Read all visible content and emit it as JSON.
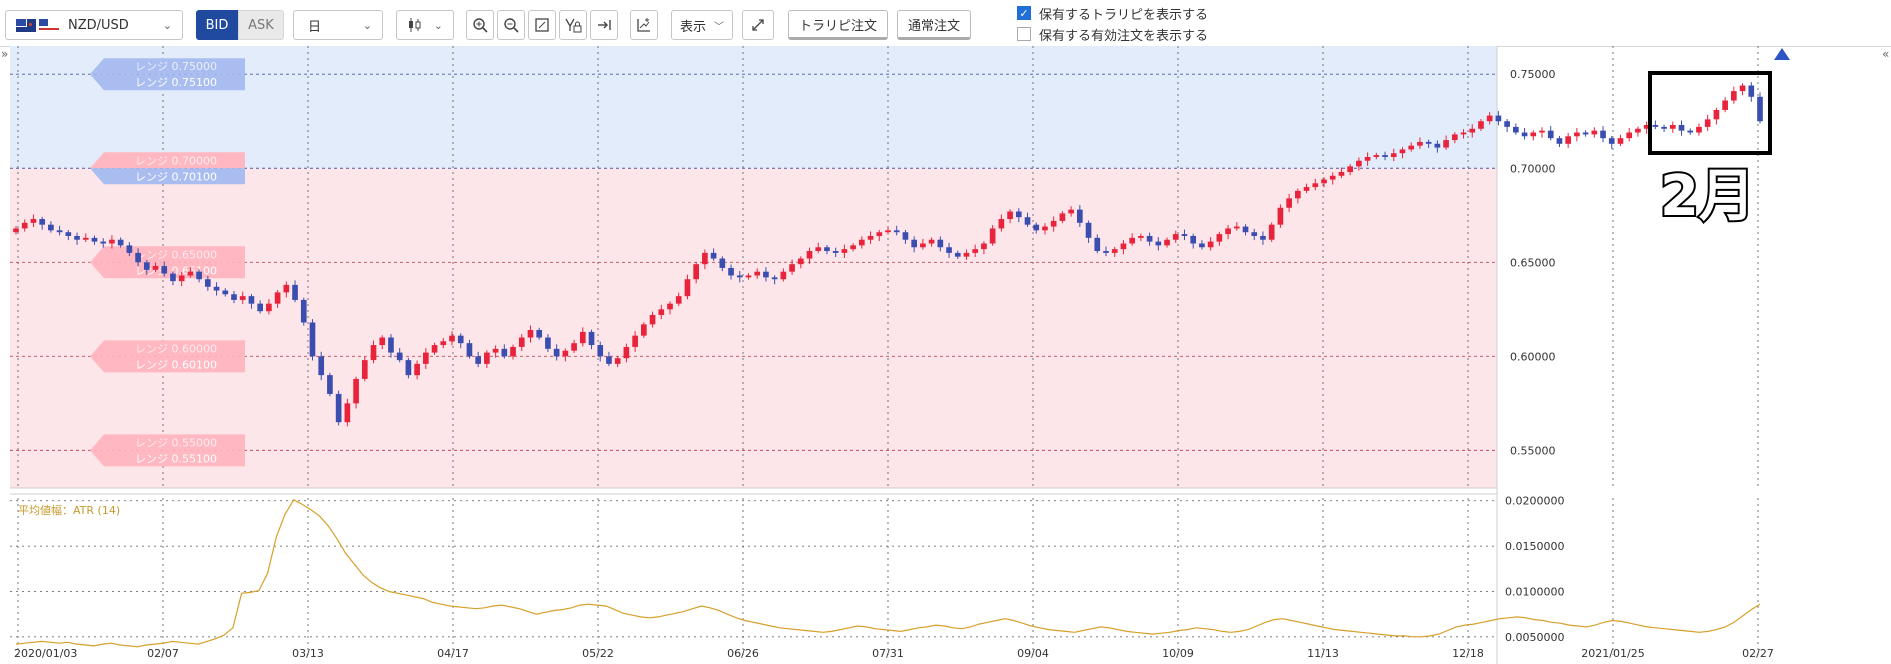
{
  "toolbar": {
    "pair_label": "NZD/USD",
    "bid_label": "BID",
    "ask_label": "ASK",
    "period_label": "日",
    "display_label": "表示",
    "trail_order_label": "トラリピ注文",
    "normal_order_label": "通常注文",
    "show_positions_label": "保有するトラリピを表示する",
    "show_positions_checked": true,
    "show_orders_label": "保有する有効注文を表示する",
    "show_orders_checked": false
  },
  "colors": {
    "up_candle": "#e8243c",
    "down_candle": "#3b4eb0",
    "range_blue_bg": "#e3ecfb",
    "range_pink_bg": "#fde6ea",
    "atr_line": "#d6a02a",
    "annotation": "#000000"
  },
  "annotation": {
    "label": "2月"
  },
  "range_labels": [
    {
      "top": "レンジ 0.75000",
      "bottom": "レンジ 0.75100",
      "side": "blue"
    },
    {
      "top": "レンジ 0.70000",
      "bottom": "レンジ 0.70100",
      "side": "split"
    },
    {
      "top": "レンジ 0.65000",
      "bottom": "レンジ 0.65100",
      "side": "pink"
    },
    {
      "top": "レンジ 0.60000",
      "bottom": "レンジ 0.60100",
      "side": "pink"
    },
    {
      "top": "レンジ 0.55000",
      "bottom": "レンジ 0.55100",
      "side": "pink"
    }
  ],
  "chart_data": [
    {
      "type": "candlestick",
      "ylim": [
        0.53,
        0.765
      ],
      "y_ticks": [
        "0.75000",
        "0.70000",
        "0.65000",
        "0.60000",
        "0.55000"
      ],
      "y_tick_values": [
        0.75,
        0.7,
        0.65,
        0.6,
        0.55
      ],
      "x_ticks": [
        "2020/01/03",
        "02/07",
        "03/13",
        "04/17",
        "05/22",
        "06/26",
        "07/31",
        "09/04",
        "10/09",
        "11/13",
        "12/18",
        "2021/01/25",
        "02/27"
      ],
      "grid": true,
      "closes": [
        0.668,
        0.671,
        0.673,
        0.67,
        0.667,
        0.666,
        0.664,
        0.662,
        0.663,
        0.661,
        0.66,
        0.662,
        0.659,
        0.655,
        0.65,
        0.646,
        0.648,
        0.644,
        0.64,
        0.643,
        0.645,
        0.641,
        0.637,
        0.635,
        0.633,
        0.63,
        0.632,
        0.628,
        0.624,
        0.628,
        0.634,
        0.638,
        0.63,
        0.618,
        0.6,
        0.59,
        0.58,
        0.565,
        0.575,
        0.588,
        0.598,
        0.606,
        0.61,
        0.602,
        0.598,
        0.59,
        0.596,
        0.602,
        0.606,
        0.608,
        0.611,
        0.607,
        0.6,
        0.596,
        0.602,
        0.604,
        0.6,
        0.605,
        0.61,
        0.614,
        0.61,
        0.604,
        0.6,
        0.603,
        0.607,
        0.613,
        0.606,
        0.6,
        0.596,
        0.599,
        0.605,
        0.611,
        0.617,
        0.622,
        0.625,
        0.628,
        0.632,
        0.641,
        0.649,
        0.655,
        0.652,
        0.647,
        0.643,
        0.642,
        0.643,
        0.645,
        0.642,
        0.641,
        0.645,
        0.649,
        0.652,
        0.656,
        0.658,
        0.656,
        0.655,
        0.657,
        0.659,
        0.662,
        0.664,
        0.666,
        0.667,
        0.666,
        0.662,
        0.658,
        0.66,
        0.662,
        0.658,
        0.655,
        0.653,
        0.655,
        0.657,
        0.66,
        0.668,
        0.673,
        0.677,
        0.674,
        0.67,
        0.667,
        0.669,
        0.672,
        0.676,
        0.678,
        0.671,
        0.663,
        0.656,
        0.655,
        0.657,
        0.66,
        0.663,
        0.664,
        0.661,
        0.659,
        0.662,
        0.665,
        0.664,
        0.66,
        0.658,
        0.661,
        0.665,
        0.668,
        0.669,
        0.666,
        0.664,
        0.662,
        0.67,
        0.679,
        0.684,
        0.688,
        0.69,
        0.692,
        0.694,
        0.696,
        0.698,
        0.701,
        0.704,
        0.706,
        0.707,
        0.706,
        0.708,
        0.71,
        0.712,
        0.714,
        0.713,
        0.711,
        0.715,
        0.718,
        0.719,
        0.721,
        0.725,
        0.728,
        0.725,
        0.722,
        0.719,
        0.717,
        0.719,
        0.72,
        0.716,
        0.713,
        0.717,
        0.719,
        0.718,
        0.72,
        0.716,
        0.713,
        0.716,
        0.719,
        0.721,
        0.723,
        0.722,
        0.721,
        0.723,
        0.72,
        0.719,
        0.722,
        0.726,
        0.731,
        0.736,
        0.741,
        0.744,
        0.738,
        0.725
      ]
    },
    {
      "type": "line",
      "series": [
        {
          "name": "平均値幅：ATR (14)"
        }
      ],
      "ylim": [
        0.003,
        0.0203
      ],
      "y_ticks": [
        "0.0200000",
        "0.0150000",
        "0.0100000",
        "0.0050000"
      ],
      "y_tick_values": [
        0.02,
        0.015,
        0.01,
        0.005
      ],
      "values": [
        0.0042,
        0.0043,
        0.0044,
        0.0045,
        0.0044,
        0.0043,
        0.0044,
        0.0042,
        0.0041,
        0.004,
        0.0042,
        0.0043,
        0.0041,
        0.004,
        0.0039,
        0.0041,
        0.0042,
        0.0043,
        0.0045,
        0.0044,
        0.0043,
        0.0042,
        0.0045,
        0.0048,
        0.0052,
        0.006,
        0.0098,
        0.0099,
        0.0101,
        0.012,
        0.016,
        0.0185,
        0.0201,
        0.0196,
        0.019,
        0.0183,
        0.0172,
        0.0158,
        0.0142,
        0.013,
        0.0118,
        0.011,
        0.0104,
        0.01,
        0.0098,
        0.0096,
        0.0094,
        0.0092,
        0.0088,
        0.0086,
        0.0084,
        0.0083,
        0.0082,
        0.0081,
        0.0082,
        0.0084,
        0.0085,
        0.0083,
        0.0081,
        0.0078,
        0.0075,
        0.0077,
        0.0079,
        0.008,
        0.0082,
        0.0085,
        0.0086,
        0.0085,
        0.0084,
        0.008,
        0.0076,
        0.0074,
        0.0072,
        0.0071,
        0.0072,
        0.0074,
        0.0076,
        0.0078,
        0.0081,
        0.0084,
        0.0082,
        0.0079,
        0.0075,
        0.0071,
        0.0068,
        0.0066,
        0.0064,
        0.0062,
        0.006,
        0.0059,
        0.0058,
        0.0057,
        0.0056,
        0.0055,
        0.0056,
        0.0058,
        0.006,
        0.0062,
        0.0061,
        0.0059,
        0.0058,
        0.0057,
        0.0056,
        0.0058,
        0.006,
        0.0061,
        0.0063,
        0.0062,
        0.006,
        0.0059,
        0.0061,
        0.0064,
        0.0066,
        0.0068,
        0.007,
        0.0068,
        0.0065,
        0.0062,
        0.006,
        0.0058,
        0.0057,
        0.0056,
        0.0055,
        0.0057,
        0.0059,
        0.0061,
        0.006,
        0.0058,
        0.0056,
        0.0055,
        0.0054,
        0.0053,
        0.0054,
        0.0055,
        0.0057,
        0.0058,
        0.006,
        0.0059,
        0.0058,
        0.0056,
        0.0055,
        0.0056,
        0.0058,
        0.0062,
        0.0066,
        0.0069,
        0.007,
        0.0068,
        0.0066,
        0.0064,
        0.0062,
        0.006,
        0.0058,
        0.0057,
        0.0056,
        0.0055,
        0.0054,
        0.0053,
        0.0052,
        0.0051,
        0.0051,
        0.005,
        0.005,
        0.0051,
        0.0053,
        0.0057,
        0.0061,
        0.0063,
        0.0064,
        0.0066,
        0.0068,
        0.007,
        0.0071,
        0.0072,
        0.0071,
        0.0069,
        0.0068,
        0.0066,
        0.0065,
        0.0063,
        0.0062,
        0.0061,
        0.0063,
        0.0066,
        0.0068,
        0.0067,
        0.0065,
        0.0063,
        0.0061,
        0.006,
        0.0059,
        0.0058,
        0.0057,
        0.0056,
        0.0055,
        0.0056,
        0.0058,
        0.0061,
        0.0066,
        0.0073,
        0.008,
        0.0086
      ]
    }
  ]
}
